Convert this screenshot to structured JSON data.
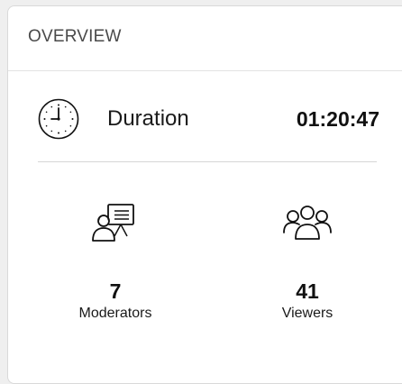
{
  "overview": {
    "title": "OVERVIEW",
    "duration": {
      "label": "Duration",
      "value": "01:20:47",
      "icon": "clock-icon"
    },
    "stats": [
      {
        "value": "7",
        "label": "Moderators",
        "icon": "presenter-icon"
      },
      {
        "value": "41",
        "label": "Viewers",
        "icon": "group-icon"
      }
    ]
  }
}
